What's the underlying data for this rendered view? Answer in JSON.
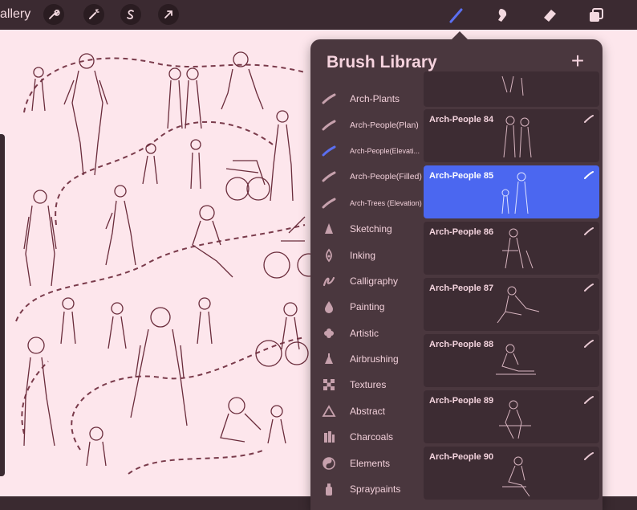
{
  "topbar": {
    "gallery_label": "allery",
    "tools": [
      "wrench-icon",
      "magic-wand-icon",
      "selection-s-icon",
      "transform-arrow-icon"
    ],
    "right_tools": [
      "brush-icon",
      "smudge-icon",
      "eraser-icon",
      "layers-icon"
    ],
    "accent": "#5b6ff0"
  },
  "panel": {
    "title": "Brush Library",
    "add_label": "+",
    "categories": [
      {
        "label": "Arch-Plants",
        "icon": "brush-stroke-icon"
      },
      {
        "label": "Arch-People(Plan)",
        "icon": "brush-stroke-icon"
      },
      {
        "label": "Arch-People(Elevati...",
        "icon": "brush-stroke-blue-icon"
      },
      {
        "label": "Arch-People(Filled)",
        "icon": "brush-stroke-icon"
      },
      {
        "label": "Arch-Trees (Elevation)",
        "icon": "brush-stroke-icon"
      },
      {
        "label": "Sketching",
        "icon": "pencil-tip-icon"
      },
      {
        "label": "Inking",
        "icon": "ink-nib-icon"
      },
      {
        "label": "Calligraphy",
        "icon": "calligraphy-icon"
      },
      {
        "label": "Painting",
        "icon": "drop-icon"
      },
      {
        "label": "Artistic",
        "icon": "flower-icon"
      },
      {
        "label": "Airbrushing",
        "icon": "airbrush-icon"
      },
      {
        "label": "Textures",
        "icon": "texture-icon"
      },
      {
        "label": "Abstract",
        "icon": "triangle-icon"
      },
      {
        "label": "Charcoals",
        "icon": "charcoal-icon"
      },
      {
        "label": "Elements",
        "icon": "yin-yang-icon"
      },
      {
        "label": "Spraypaints",
        "icon": "spraycan-icon"
      }
    ],
    "brushes": [
      {
        "name": "",
        "selected": false
      },
      {
        "name": "Arch-People 84",
        "selected": false
      },
      {
        "name": "Arch-People 85",
        "selected": true
      },
      {
        "name": "Arch-People 86",
        "selected": false
      },
      {
        "name": "Arch-People 87",
        "selected": false
      },
      {
        "name": "Arch-People 88",
        "selected": false
      },
      {
        "name": "Arch-People 89",
        "selected": false
      },
      {
        "name": "Arch-People 90",
        "selected": false
      }
    ]
  },
  "colors": {
    "canvas": "#fde6ec",
    "panel": "#4a373e",
    "selected": "#4b67f0"
  }
}
